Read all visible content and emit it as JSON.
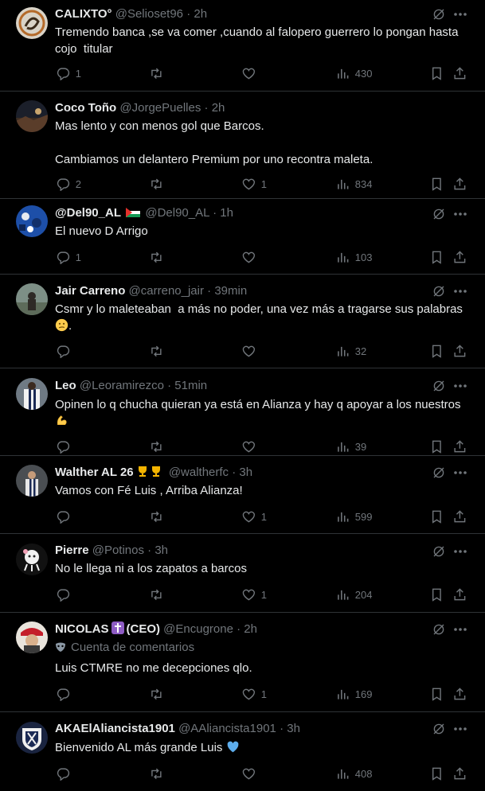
{
  "colors": {
    "background": "#000000",
    "text": "#e7e9ea",
    "secondary": "#71767b",
    "divider": "#2f3336"
  },
  "tweets": [
    {
      "name": "CALIXTO°",
      "handle": "@Selioset96",
      "sep": "·",
      "time": "2h",
      "text": "Tremendo banca ,se va comer ,cuando al falopero guerrero lo pongan hasta\ncojo  titular",
      "replies": "1",
      "retweets": "",
      "likes": "",
      "views": "430"
    },
    {
      "name": "Coco Toño",
      "handle": "@JorgePuelles",
      "sep": "·",
      "time": "2h",
      "text": "Mas lento y con menos gol que Barcos.\n\nCambiamos un delantero Premium por uno recontra maleta.",
      "replies": "2",
      "retweets": "",
      "likes": "1",
      "views": "834"
    },
    {
      "name": "@Del90_AL",
      "flag_icon": "palestine-flag-icon",
      "handle": "@Del90_AL",
      "sep": "·",
      "time": "1h",
      "text": "El nuevo D Arrigo",
      "replies": "1",
      "retweets": "",
      "likes": "",
      "views": "103"
    },
    {
      "name": "Jair Carreno",
      "handle": "@carreno_jair",
      "sep": "·",
      "time": "39min",
      "text": "Csmr y lo maleteaban  a más no poder, una vez más a tragarse sus palabras",
      "emoji_icon": "confused-face-emoji",
      "replies": "",
      "retweets": "",
      "likes": "",
      "views": "32"
    },
    {
      "name": "Leo",
      "handle": "@Leoramirezco",
      "sep": "·",
      "time": "51min",
      "text": "Opinen lo q chucha quieran ya está en Alianza y hay q apoyar a los nuestros",
      "emoji_icon": "flexed-biceps-emoji",
      "replies": "",
      "retweets": "",
      "likes": "",
      "views": "39"
    },
    {
      "name": "Walther AL 26",
      "name_icons": "two-trophy-emoji",
      "handle": "@waltherfc",
      "sep": "·",
      "time": "3h",
      "text": "Vamos con Fé Luis , Arriba Alianza!",
      "replies": "",
      "retweets": "",
      "likes": "1",
      "views": "599"
    },
    {
      "name": "Pierre",
      "handle": "@Potinos",
      "sep": "·",
      "time": "3h",
      "text": "No le llega ni a los zapatos a barcos",
      "replies": "",
      "retweets": "",
      "likes": "1",
      "views": "204"
    },
    {
      "name": "NICOLAS",
      "name_suffix": "(CEO)",
      "badge_icon": "latin-cross-emoji",
      "handle": "@Encugrone",
      "sep": "·",
      "time": "2h",
      "subtitle": "Cuenta de comentarios",
      "subtitle_icon": "masks-icon",
      "text": "Luis CTMRE no me decepciones qlo.",
      "replies": "",
      "retweets": "",
      "likes": "1",
      "views": "169"
    },
    {
      "name": "AKAElAliancista1901",
      "handle": "@AAliancista1901",
      "sep": "·",
      "time": "3h",
      "text": "Bienvenido AL más grande Luis",
      "emoji_icon": "blue-heart-emoji",
      "replies": "",
      "retweets": "",
      "likes": "",
      "views": "408"
    }
  ]
}
